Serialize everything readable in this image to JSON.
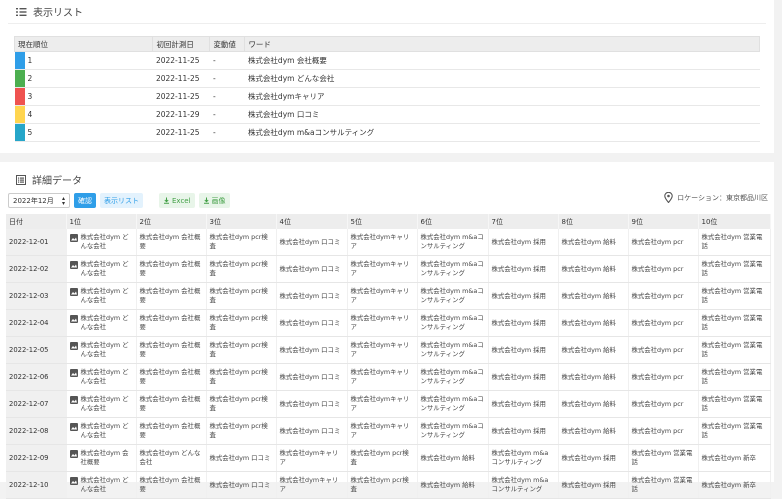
{
  "list_section": {
    "title": "表示リスト",
    "columns": [
      "現在順位",
      "初回計測日",
      "変動値",
      "ワード"
    ],
    "rows": [
      {
        "color": "#2f9ee8",
        "rank": "1",
        "date": "2022-11-25",
        "change": "-",
        "word": "株式会社dym 会社概要"
      },
      {
        "color": "#4caf50",
        "rank": "2",
        "date": "2022-11-25",
        "change": "-",
        "word": "株式会社dym どんな会社"
      },
      {
        "color": "#ef5350",
        "rank": "3",
        "date": "2022-11-25",
        "change": "-",
        "word": "株式会社dymキャリア"
      },
      {
        "color": "#ffd54f",
        "rank": "4",
        "date": "2022-11-29",
        "change": "-",
        "word": "株式会社dym 口コミ"
      },
      {
        "color": "#26a6c9",
        "rank": "5",
        "date": "2022-11-25",
        "change": "-",
        "word": "株式会社dym m&aコンサルティング"
      }
    ]
  },
  "detail_section": {
    "title": "詳細データ",
    "month_select": "2022年12月",
    "confirm_label": "確認",
    "list_label": "表示リスト",
    "excel_label": "Excel",
    "image_label": "画像",
    "location": "ロケーション：東京都品川区",
    "columns": [
      "日付",
      "1位",
      "2位",
      "3位",
      "4位",
      "5位",
      "6位",
      "7位",
      "8位",
      "9位",
      "10位"
    ],
    "rows": [
      {
        "date": "2022-12-01",
        "cells": [
          "株式会社dym どんな会社",
          "株式会社dym 会社概要",
          "株式会社dym pcr検査",
          "株式会社dym 口コミ",
          "株式会社dymキャリア",
          "株式会社dym m&aコンサルティング",
          "株式会社dym 採用",
          "株式会社dym 給料",
          "株式会社dym pcr",
          "株式会社dym 営業電話"
        ]
      },
      {
        "date": "2022-12-02",
        "cells": [
          "株式会社dym どんな会社",
          "株式会社dym 会社概要",
          "株式会社dym pcr検査",
          "株式会社dym 口コミ",
          "株式会社dymキャリア",
          "株式会社dym m&aコンサルティング",
          "株式会社dym 採用",
          "株式会社dym 給料",
          "株式会社dym pcr",
          "株式会社dym 営業電話"
        ]
      },
      {
        "date": "2022-12-03",
        "cells": [
          "株式会社dym どんな会社",
          "株式会社dym 会社概要",
          "株式会社dym pcr検査",
          "株式会社dym 口コミ",
          "株式会社dymキャリア",
          "株式会社dym m&aコンサルティング",
          "株式会社dym 採用",
          "株式会社dym 給料",
          "株式会社dym pcr",
          "株式会社dym 営業電話"
        ]
      },
      {
        "date": "2022-12-04",
        "cells": [
          "株式会社dym どんな会社",
          "株式会社dym 会社概要",
          "株式会社dym pcr検査",
          "株式会社dym 口コミ",
          "株式会社dymキャリア",
          "株式会社dym m&aコンサルティング",
          "株式会社dym 採用",
          "株式会社dym 給料",
          "株式会社dym pcr",
          "株式会社dym 営業電話"
        ]
      },
      {
        "date": "2022-12-05",
        "cells": [
          "株式会社dym どんな会社",
          "株式会社dym 会社概要",
          "株式会社dym pcr検査",
          "株式会社dym 口コミ",
          "株式会社dymキャリア",
          "株式会社dym m&aコンサルティング",
          "株式会社dym 採用",
          "株式会社dym 給料",
          "株式会社dym pcr",
          "株式会社dym 営業電話"
        ]
      },
      {
        "date": "2022-12-06",
        "cells": [
          "株式会社dym どんな会社",
          "株式会社dym 会社概要",
          "株式会社dym pcr検査",
          "株式会社dym 口コミ",
          "株式会社dymキャリア",
          "株式会社dym m&aコンサルティング",
          "株式会社dym 採用",
          "株式会社dym 給料",
          "株式会社dym pcr",
          "株式会社dym 営業電話"
        ]
      },
      {
        "date": "2022-12-07",
        "cells": [
          "株式会社dym どんな会社",
          "株式会社dym 会社概要",
          "株式会社dym pcr検査",
          "株式会社dym 口コミ",
          "株式会社dymキャリア",
          "株式会社dym m&aコンサルティング",
          "株式会社dym 採用",
          "株式会社dym 給料",
          "株式会社dym pcr",
          "株式会社dym 営業電話"
        ]
      },
      {
        "date": "2022-12-08",
        "cells": [
          "株式会社dym どんな会社",
          "株式会社dym 会社概要",
          "株式会社dym pcr検査",
          "株式会社dym 口コミ",
          "株式会社dymキャリア",
          "株式会社dym m&aコンサルティング",
          "株式会社dym 採用",
          "株式会社dym 給料",
          "株式会社dym pcr",
          "株式会社dym 営業電話"
        ]
      },
      {
        "date": "2022-12-09",
        "cells": [
          "株式会社dym 会社概要",
          "株式会社dym どんな会社",
          "株式会社dym 口コミ",
          "株式会社dymキャリア",
          "株式会社dym pcr検査",
          "株式会社dym 給料",
          "株式会社dym m&aコンサルティング",
          "株式会社dym 採用",
          "株式会社dym 営業電話",
          "株式会社dym 新卒"
        ]
      },
      {
        "date": "2022-12-10",
        "cells": [
          "株式会社dym どんな会社",
          "株式会社dym 会社概要",
          "株式会社dym 口コミ",
          "株式会社dymキャリア",
          "株式会社dym pcr検査",
          "株式会社dym 給料",
          "株式会社dym m&aコンサルティング",
          "株式会社dym 採用",
          "株式会社dym 営業電話",
          "株式会社dym 新卒"
        ]
      }
    ]
  }
}
